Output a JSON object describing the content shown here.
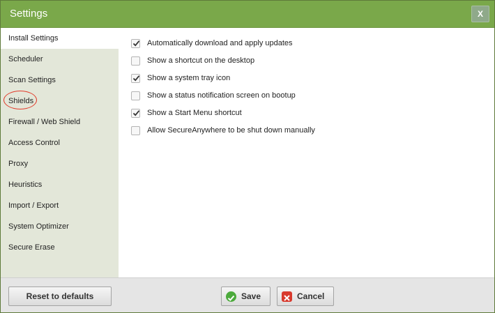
{
  "window": {
    "title": "Settings",
    "close_label": "X"
  },
  "sidebar": {
    "items": [
      {
        "label": "Install Settings",
        "active": true
      },
      {
        "label": "Scheduler"
      },
      {
        "label": "Scan Settings"
      },
      {
        "label": "Shields",
        "highlighted": true
      },
      {
        "label": "Firewall / Web Shield"
      },
      {
        "label": "Access Control"
      },
      {
        "label": "Proxy"
      },
      {
        "label": "Heuristics"
      },
      {
        "label": "Import / Export"
      },
      {
        "label": "System Optimizer"
      },
      {
        "label": "Secure Erase"
      }
    ]
  },
  "options": [
    {
      "label": "Automatically download and apply updates",
      "checked": true
    },
    {
      "label": "Show a shortcut on the desktop",
      "checked": false
    },
    {
      "label": "Show a system tray icon",
      "checked": true
    },
    {
      "label": "Show a status notification screen on bootup",
      "checked": false
    },
    {
      "label": "Show a Start Menu shortcut",
      "checked": true
    },
    {
      "label": "Allow SecureAnywhere to be shut down manually",
      "checked": false
    }
  ],
  "footer": {
    "reset_label": "Reset to defaults",
    "save_label": "Save",
    "cancel_label": "Cancel"
  },
  "colors": {
    "titlebar": "#7aa84a",
    "sidebar": "#e3e7d9",
    "highlight_ring": "#e23b2b",
    "save_icon": "#4caa3c",
    "cancel_icon": "#d83a2e"
  },
  "icons": {
    "close": "close-icon",
    "save": "check-circle-icon",
    "cancel": "x-box-icon",
    "checkbox": "check-icon"
  }
}
